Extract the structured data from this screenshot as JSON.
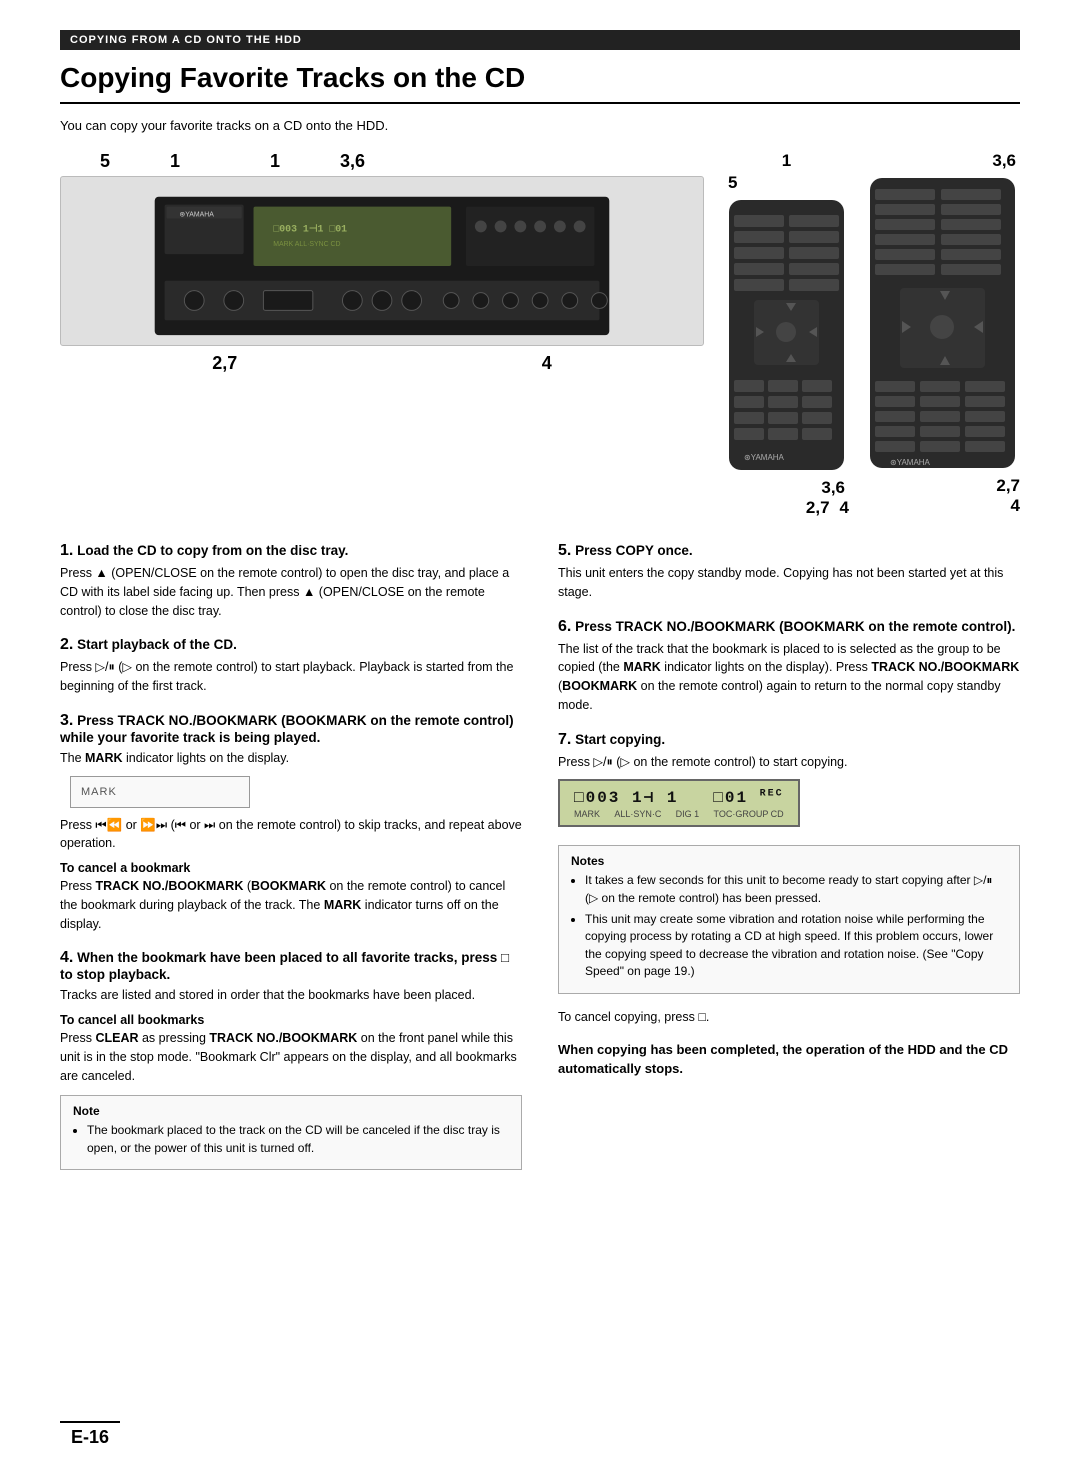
{
  "header_bar": "COPYING FROM A CD ONTO THE HDD",
  "page_title": "Copying Favorite Tracks on the CD",
  "intro": "You can copy your favorite tracks on a CD onto the HDD.",
  "diagram_labels_device": {
    "label5a": "5",
    "label1a": "1",
    "label1b": "1",
    "label36a": "3,6",
    "label27a": "2,7",
    "label4a": "4"
  },
  "diagram_labels_remote1": {
    "label1": "1",
    "label5": "5",
    "label36": "3,6",
    "label27": "2,7",
    "label4": "4"
  },
  "steps_left": [
    {
      "num": "1",
      "title": "Load the CD to copy from on the disc tray.",
      "body": "Press ▲ (OPEN/CLOSE on the remote control) to open the disc tray, and place a CD with its label side facing up. Then press ▲ (OPEN/CLOSE on the remote control) to close the disc tray."
    },
    {
      "num": "2",
      "title": "Start playback of the CD.",
      "body": "Press ▷/⏸ (▷ on the remote control) to start playback. Playback is started from the beginning of the first track."
    },
    {
      "num": "3",
      "title": "Press TRACK NO./BOOKMARK (BOOKMARK on the remote control) while your favorite track is being played.",
      "body": "The MARK indicator lights on the display.",
      "mark_box": "MARK",
      "sub_title1": "To cancel a bookmark",
      "sub_body1": "Press TRACK NO./BOOKMARK (BOOKMARK on the remote control) to cancel the bookmark during playback of the track. The MARK indicator turns off on the display.",
      "extra_body": "Press ⏮/⏪ or ⏩/⏭ (⏮ or ⏭ on the remote control) to skip tracks, and repeat above operation."
    },
    {
      "num": "4",
      "title": "When the bookmark have been placed to all favorite tracks, press □ to stop playback.",
      "body": "Tracks are listed and stored in order that the bookmarks have been placed.",
      "sub_title1": "To cancel all bookmarks",
      "sub_body1": "Press CLEAR as pressing TRACK NO./BOOKMARK on the front panel while this unit is in the stop mode. \"Bookmark Clr\" appears on the display, and all bookmarks are canceled.",
      "note_title": "Note",
      "note_items": [
        "The bookmark placed to the track on the CD will be canceled if the disc tray is open, or the power of this unit is turned off."
      ]
    }
  ],
  "steps_right": [
    {
      "num": "5",
      "title": "Press COPY once.",
      "body": "This unit enters the copy standby mode. Copying has not been started yet at this stage."
    },
    {
      "num": "6",
      "title": "Press TRACK NO./BOOKMARK (BOOKMARK on the remote control).",
      "body": "The list of the track that the bookmark is placed to is selected as the group to be copied (the MARK indicator lights on the display). Press TRACK NO./BOOKMARK (BOOKMARK on the remote control) again to return to the normal copy standby mode."
    },
    {
      "num": "7",
      "title": "Start copying.",
      "body": "Press ▷/⏸ (▷ on the remote control) to start copying.",
      "display_text": "□003  1⊣  1    □01 ' REC",
      "display_sub": [
        "MARK",
        "ALL·SYN·C",
        "DIG\n1",
        "TOC·GROUP\nCD"
      ],
      "notes_title": "Notes",
      "notes_items": [
        "It takes a few seconds for this unit to become ready to start copying after ▷/⏸ (▷ on the remote control) has been pressed.",
        "This unit may create some vibration and rotation noise while performing the copying process by rotating a CD at high speed. If this problem occurs, lower the copying speed to decrease the vibration and rotation noise. (See \"Copy Speed\" on page 19.)"
      ]
    }
  ],
  "cancel_copy_note": "To cancel copying, press □.",
  "bold_footer": "When copying has been completed, the operation of the HDD and the CD automatically stops.",
  "page_number": "E-16"
}
